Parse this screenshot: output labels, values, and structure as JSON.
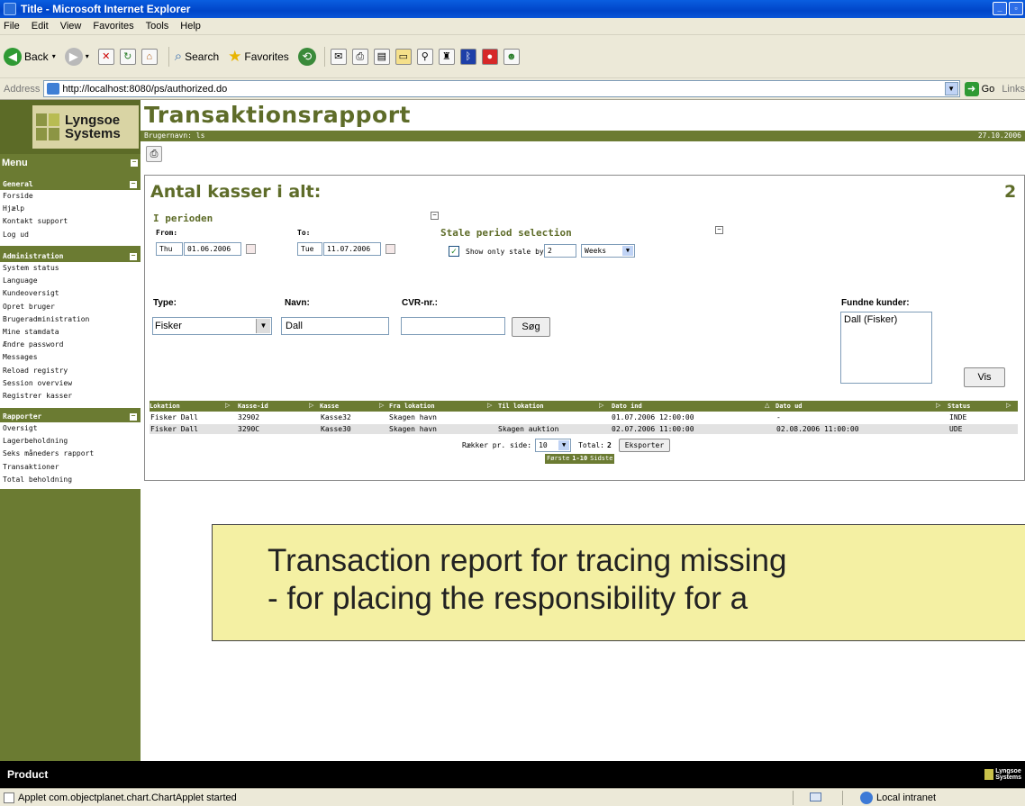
{
  "window": {
    "title": "Title - Microsoft Internet Explorer"
  },
  "menubar": [
    "File",
    "Edit",
    "View",
    "Favorites",
    "Tools",
    "Help"
  ],
  "toolbar": {
    "back": "Back",
    "search": "Search",
    "favorites": "Favorites"
  },
  "address": {
    "label": "Address",
    "url": "http://localhost:8080/ps/authorized.do",
    "go": "Go",
    "links": "Links"
  },
  "logo": {
    "line1": "Lyngsoe",
    "line2": "Systems"
  },
  "sidebar": {
    "menu_title": "Menu",
    "sections": [
      {
        "title": "General",
        "items": [
          "Forside",
          "Hjælp",
          "Kontakt support",
          "Log ud"
        ]
      },
      {
        "title": "Administration",
        "items": [
          "System status",
          "Language",
          "Kundeoversigt",
          "Opret bruger",
          "Brugeradministration",
          "Mine stamdata",
          "Ændre password",
          "Messages",
          "Reload registry",
          "Session overview",
          "Registrer kasser"
        ]
      },
      {
        "title": "Rapporter",
        "items": [
          "Oversigt",
          "Lagerbeholdning",
          "Seks måneders rapport",
          "Transaktioner",
          "Total beholdning"
        ]
      }
    ]
  },
  "header": {
    "title": "Transaktionsrapport",
    "user": "Brugernavn: ls",
    "date": "27.10.2006"
  },
  "panel": {
    "title": "Antal kasser i alt:",
    "count": "2",
    "period_label": "I perioden",
    "from_label": "From:",
    "to_label": "To:",
    "from_day": "Thu",
    "from_date": "01.06.2006",
    "to_day": "Tue",
    "to_date": "11.07.2006",
    "stale_title": "Stale period selection",
    "stale_check_label": "Show only stale by",
    "stale_value": "2",
    "stale_unit": "Weeks"
  },
  "search": {
    "type_label": "Type:",
    "type_value": "Fisker",
    "name_label": "Navn:",
    "name_value": "Dall",
    "cvr_label": "CVR-nr.:",
    "cvr_value": "",
    "search_button": "Søg",
    "found_label": "Fundne kunder:",
    "found_items": [
      "Dall (Fisker)"
    ],
    "show_button": "Vis"
  },
  "table": {
    "columns": [
      "Lokation",
      "Kasse-id",
      "Kasse",
      "Fra lokation",
      "Til lokation",
      "Dato ind",
      "Dato ud",
      "Status"
    ],
    "rows": [
      [
        "Fisker Dall",
        "32902",
        "Kasse32",
        "Skagen havn",
        "",
        "01.07.2006 12:00:00",
        "-",
        "INDE"
      ],
      [
        "Fisker Dall",
        "3290C",
        "Kasse30",
        "Skagen havn",
        "Skagen auktion",
        "02.07.2006 11:00:00",
        "02.08.2006 11:00:00",
        "UDE"
      ]
    ],
    "rows_label": "Rækker pr. side:",
    "rows_per_page": "10",
    "total_label": "Total:",
    "total_value": "2",
    "export_button": "Eksporter",
    "pager": [
      "Første",
      "1-10",
      "Sidste"
    ]
  },
  "callout": {
    "line1": "Transaction report for tracing missing",
    "line2": "- for placing the responsibility for a"
  },
  "footer": {
    "label": "Product",
    "logo_line1": "Lyngsoe",
    "logo_line2": "Systems"
  },
  "statusbar": {
    "text": "Applet com.objectplanet.chart.ChartApplet started",
    "zone": "Local intranet"
  }
}
